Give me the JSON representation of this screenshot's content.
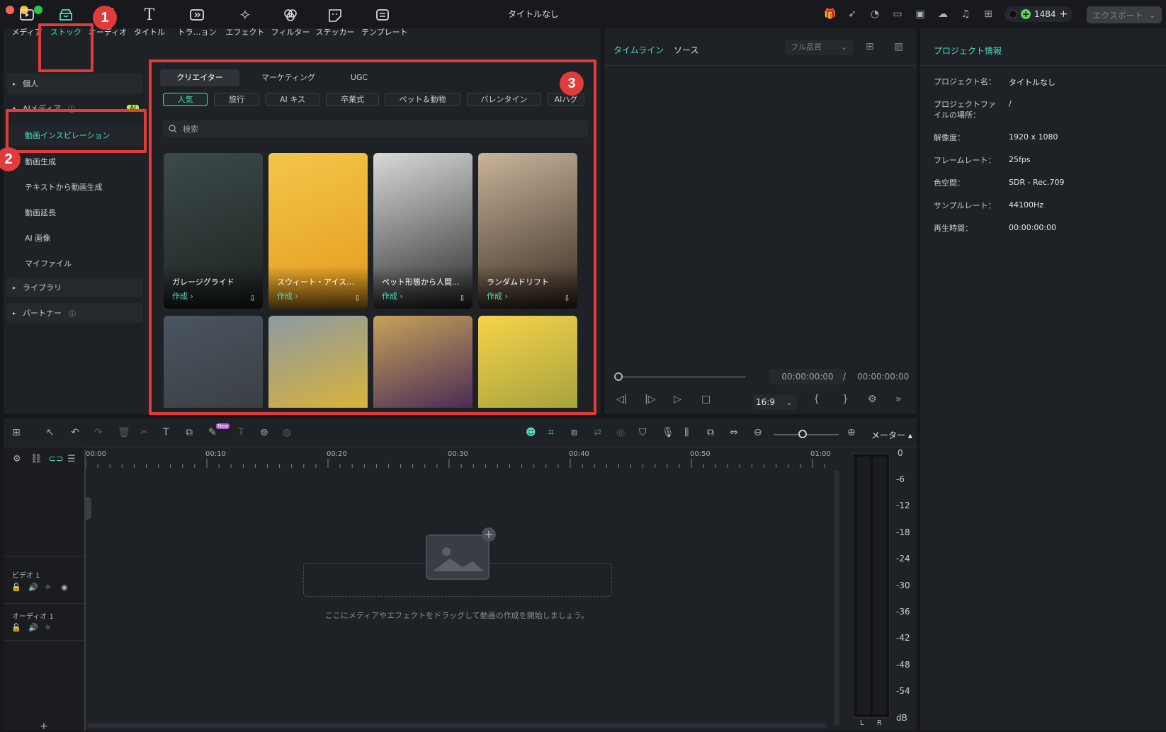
{
  "window": {
    "title": "タイトルなし"
  },
  "topbar": {
    "credits": "1484",
    "export_label": "エクスポート"
  },
  "nav_tabs": [
    {
      "label": "メディア"
    },
    {
      "label": "ストック"
    },
    {
      "label": "オーディオ"
    },
    {
      "label": "タイトル"
    },
    {
      "label": "トラ…ョン"
    },
    {
      "label": "エフェクト"
    },
    {
      "label": "フィルター"
    },
    {
      "label": "ステッカー"
    },
    {
      "label": "テンプレート"
    }
  ],
  "sidebar": {
    "group_personal": "個人",
    "group_ai_media": "AIメディア",
    "ai_badge": "AI",
    "items": [
      "動画インスピレーション",
      "動画生成",
      "テキストから動画生成",
      "動画延長",
      "AI 画像",
      "マイファイル"
    ],
    "group_library": "ライブラリ",
    "group_partner": "パートナー"
  },
  "content": {
    "tabs": [
      "クリエイター",
      "マーケティング",
      "UGC"
    ],
    "chips": [
      "人気",
      "旅行",
      "AI キス",
      "卒業式",
      "ペット＆動物",
      "バレンタイン",
      "AIハグ"
    ],
    "search_placeholder": "検索",
    "cards": [
      {
        "name": "ガレージグライド",
        "cta": "作成",
        "colors": [
          "#3d4a4a",
          "#1d2322"
        ]
      },
      {
        "name": "スウィート・アイス…",
        "cta": "作成",
        "colors": [
          "#f3c64b",
          "#e59a1d"
        ]
      },
      {
        "name": "ペット形態から人間…",
        "cta": "作成",
        "colors": [
          "#d9dad7",
          "#2a2c2e"
        ]
      },
      {
        "name": "ランダムドリフト",
        "cta": "作成",
        "colors": [
          "#c9b39a",
          "#3a2d22"
        ]
      },
      {
        "name": "",
        "cta": "",
        "colors": [
          "#4b5560",
          "#3a3f44"
        ]
      },
      {
        "name": "",
        "cta": "",
        "colors": [
          "#8c9aa3",
          "#d9b33a"
        ]
      },
      {
        "name": "",
        "cta": "",
        "colors": [
          "#c7a25a",
          "#4a2c55"
        ]
      },
      {
        "name": "",
        "cta": "",
        "colors": [
          "#f6d34a",
          "#a7a33e"
        ]
      }
    ]
  },
  "annotations": [
    "1",
    "2",
    "3"
  ],
  "preview": {
    "tab_timeline": "タイムライン",
    "tab_source": "ソース",
    "quality": "フル品質",
    "time_current": "00:00:00:00",
    "time_separator": "/",
    "time_total": "00:00:00:00",
    "aspect": "16:9"
  },
  "project_info": {
    "title": "プロジェクト情報",
    "rows": [
      {
        "k": "プロジェクト名：",
        "v": "タイトルなし"
      },
      {
        "k": "プロジェクトファイルの場所：",
        "v": "/"
      },
      {
        "k": "解像度：",
        "v": "1920 x 1080"
      },
      {
        "k": "フレームレート：",
        "v": "25fps"
      },
      {
        "k": "色空間：",
        "v": "SDR - Rec.709"
      },
      {
        "k": "サンプルレート：",
        "v": "44100Hz"
      },
      {
        "k": "再生時間：",
        "v": "00:00:00:00"
      }
    ]
  },
  "timeline": {
    "meter_label": "メーター",
    "ruler": [
      "00:00",
      "00:10",
      "00:20",
      "00:30",
      "00:40",
      "00:50",
      "01:00"
    ],
    "track_video": "ビデオ 1",
    "track_audio": "オーディオ 1",
    "drop_hint": "ここにメディアやエフェクトをドラッグして動画の作成を開始しましょう。",
    "db_scale": [
      "0",
      "-6",
      "-12",
      "-18",
      "-24",
      "-30",
      "-36",
      "-42",
      "-48",
      "-54",
      "dB"
    ],
    "meter_l": "L",
    "meter_r": "R",
    "new_badge": "New"
  },
  "colors": {
    "accent": "#4ddcc0",
    "annotation": "#e23b3b",
    "panel": "#1e2125"
  }
}
